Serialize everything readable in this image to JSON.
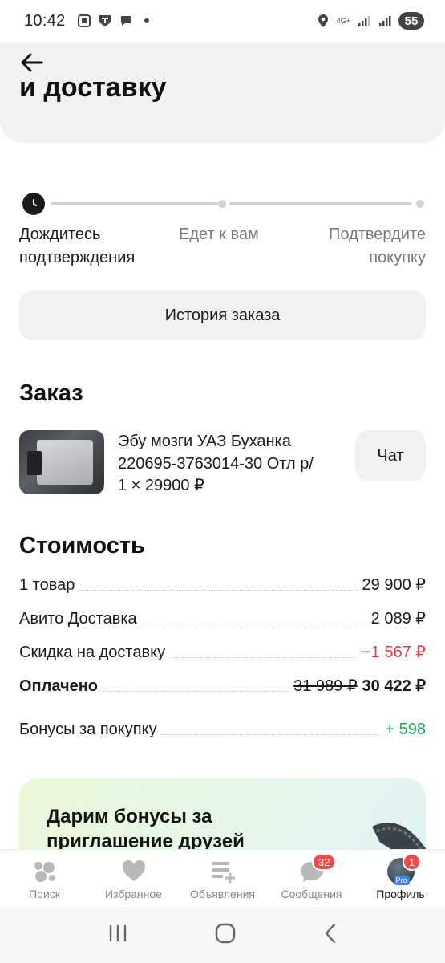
{
  "status_bar": {
    "time": "10:42",
    "network": "4G+",
    "battery": "55"
  },
  "header": {
    "title": "и доставку"
  },
  "stepper": {
    "steps": [
      {
        "label_line1": "Дождитесь",
        "label_line2": "подтверждения",
        "state": "done"
      },
      {
        "label_line1": "Едет к вам",
        "label_line2": "",
        "state": "pending"
      },
      {
        "label_line1": "Подтвердите",
        "label_line2": "покупку",
        "state": "pending"
      }
    ]
  },
  "history_button": "История заказа",
  "order": {
    "section_title": "Заказ",
    "item_name": "Эбу мозги УАЗ Буханка 220695-3763014-30 Отл р/",
    "item_qty": "1 × 29900 ₽",
    "chat_label": "Чат"
  },
  "cost": {
    "section_title": "Стоимость",
    "rows": [
      {
        "label": "1 товар",
        "value": "29 900 ₽"
      },
      {
        "label": "Авито Доставка",
        "value": "2 089 ₽"
      },
      {
        "label": "Скидка на доставку",
        "value": "−1 567 ₽"
      }
    ],
    "paid": {
      "label": "Оплачено",
      "old_value": "31 989 ₽",
      "value": "30 422 ₽"
    },
    "bonus": {
      "label": "Бонусы за покупку",
      "value": "+ 598"
    }
  },
  "promo": {
    "title": "Дарим бонусы за приглашение друзей"
  },
  "bottom_nav": {
    "items": [
      {
        "label": "Поиск",
        "icon": "search-bubbles-icon"
      },
      {
        "label": "Избранное",
        "icon": "heart-icon"
      },
      {
        "label": "Объявления",
        "icon": "ads-icon"
      },
      {
        "label": "Сообщения",
        "icon": "chat-icon",
        "badge": "32"
      },
      {
        "label": "Профиль",
        "icon": "avatar",
        "badge": "1",
        "tag": "Pro"
      }
    ]
  },
  "colors": {
    "accent_negative": "#e53946",
    "accent_positive": "#1faa5a",
    "badge": "#f24a4a",
    "surface": "#f2f1f0"
  }
}
